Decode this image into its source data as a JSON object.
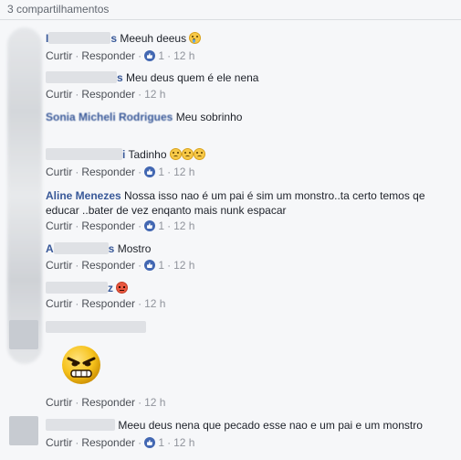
{
  "header": {
    "shares": "3 compartilhamentos"
  },
  "actions": {
    "like": "Curtir",
    "reply": "Responder",
    "dot": "·",
    "likes_one": "1"
  },
  "comments": [
    {
      "name_visible": "I",
      "name_tail": "s",
      "text": "Meeuh deeus",
      "likes": "1",
      "time": "12 h",
      "emoji": "tear-icon"
    },
    {
      "name_visible": "",
      "name_tail": "s",
      "text": "Meu deus quem é ele nena",
      "likes": "",
      "time": "12 h"
    },
    {
      "name_visible": "Sonia Micheli Rodrigues",
      "name_tail": "",
      "text": "Meu sobrinho",
      "likes": "",
      "time": ""
    },
    {
      "name_visible": "",
      "name_tail": "i",
      "text": "Tadinho",
      "likes": "1",
      "time": "12 h",
      "emoji": "worried-icon"
    },
    {
      "name_visible": "Aline Menezes",
      "name_tail": "",
      "text": "Nossa isso nao é um pai é sim um monstro..ta certo temos qe educar ..bater de vez enqanto mais nunk espacar",
      "likes": "1",
      "time": "12 h"
    },
    {
      "name_visible": "A",
      "name_tail": "s",
      "text": "Mostro",
      "likes": "1",
      "time": "12 h"
    },
    {
      "name_visible": "",
      "name_tail": "z",
      "text": "",
      "likes": "",
      "time": "12 h",
      "emoji": "angry-icon"
    },
    {
      "name_visible": "",
      "name_tail": "",
      "text": "",
      "likes": "",
      "time": "12 h",
      "sticker": "angry-face-sticker"
    },
    {
      "name_visible": "",
      "name_tail": "",
      "text": "Meeu deus nena que pecado esse nao e um pai e um monstro",
      "likes": "1",
      "time": "12 h"
    }
  ]
}
